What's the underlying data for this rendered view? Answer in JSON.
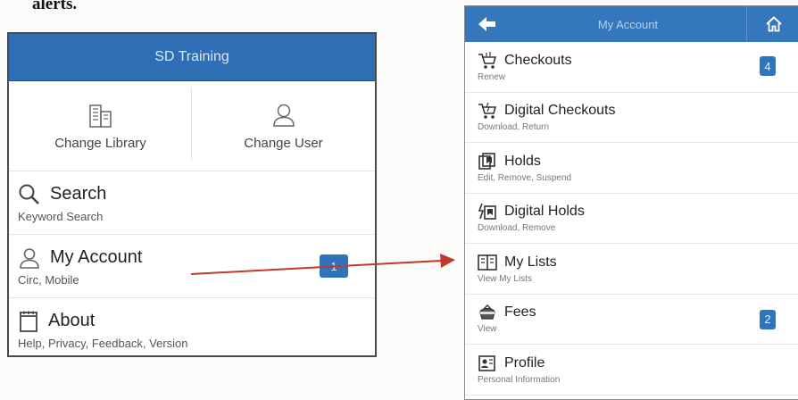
{
  "doc_fragment": "alerts.",
  "left_app": {
    "header_title": "SD Training",
    "change_library_label": "Change Library",
    "change_user_label": "Change User",
    "items": [
      {
        "title": "Search",
        "subtitle": "Keyword Search"
      },
      {
        "title": "My Account",
        "subtitle": "Circ, Mobile",
        "badge": "1"
      },
      {
        "title": "About",
        "subtitle": "Help, Privacy, Feedback, Version"
      }
    ]
  },
  "right_app": {
    "header_title": "My Account",
    "items": [
      {
        "title": "Checkouts",
        "subtitle": "Renew",
        "badge": "4"
      },
      {
        "title": "Digital Checkouts",
        "subtitle": "Download, Return"
      },
      {
        "title": "Holds",
        "subtitle": "Edit, Remove, Suspend"
      },
      {
        "title": "Digital Holds",
        "subtitle": "Download, Remove"
      },
      {
        "title": "My Lists",
        "subtitle": "View My Lists"
      },
      {
        "title": "Fees",
        "subtitle": "View",
        "badge": "2"
      },
      {
        "title": "Profile",
        "subtitle": "Personal Information"
      }
    ]
  },
  "colors": {
    "header_blue": "#2f6eb5",
    "badge_blue": "#2f73bb",
    "arrow_red": "#c0392b"
  }
}
